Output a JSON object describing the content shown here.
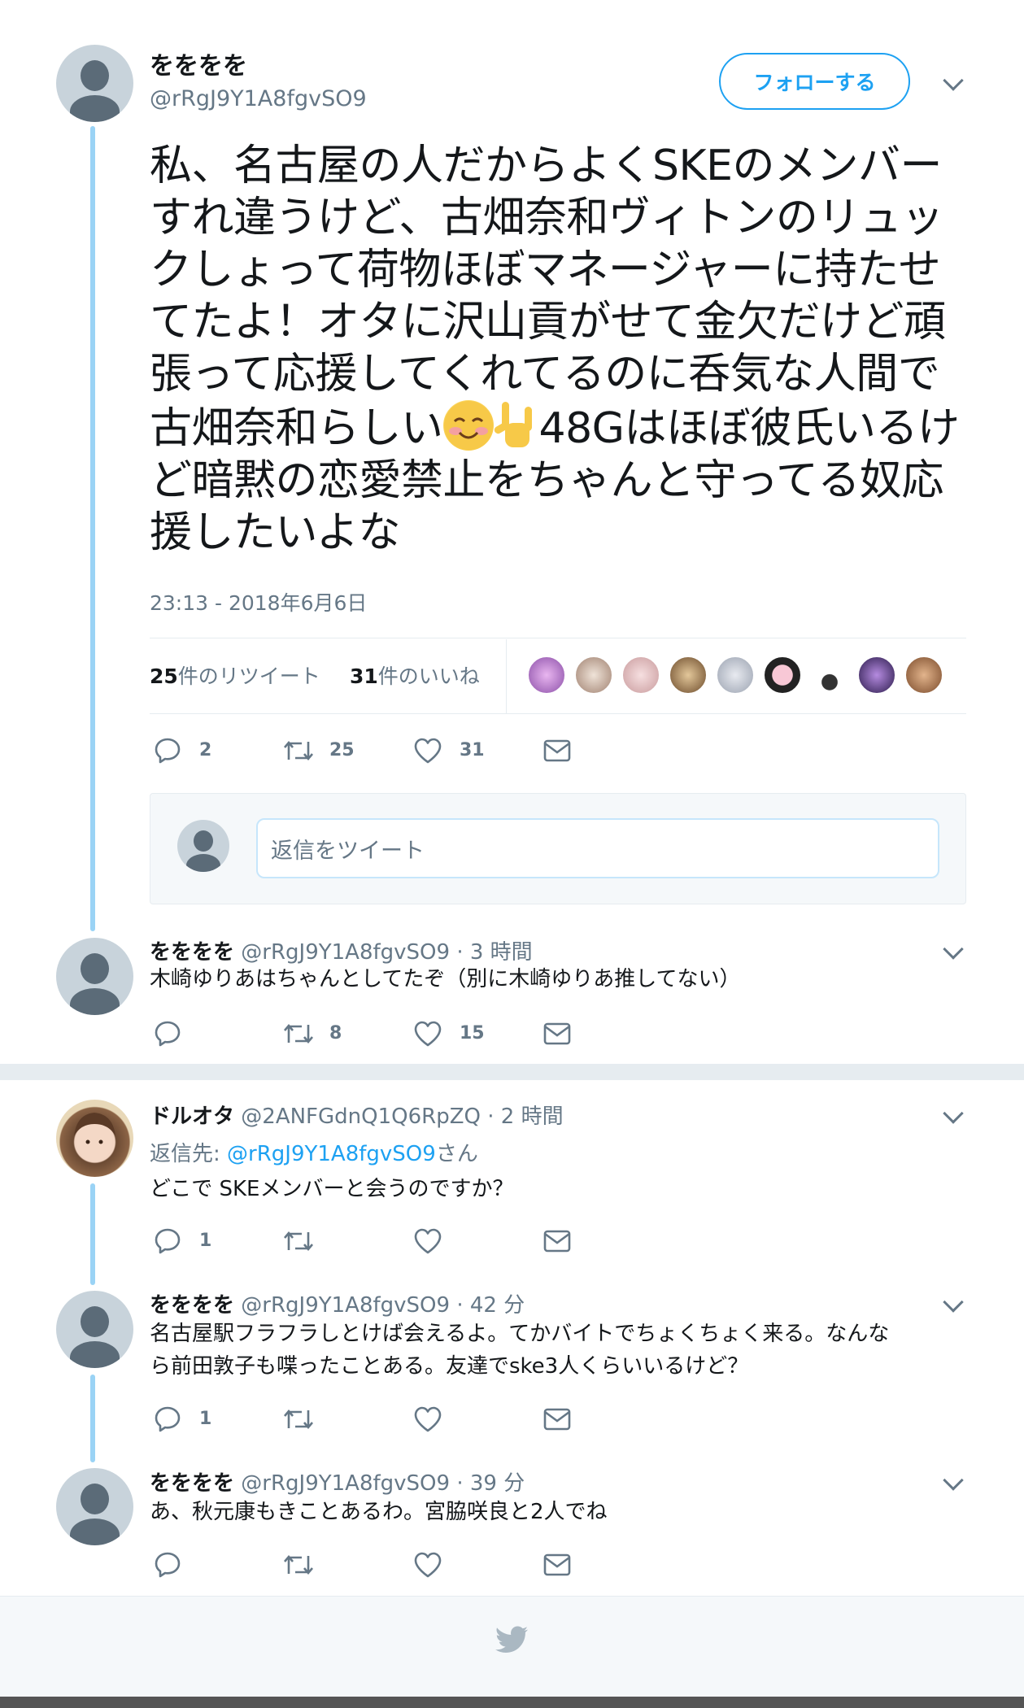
{
  "main_tweet": {
    "name": "をををを",
    "handle": "@rRgJ9Y1A8fgvSO9",
    "follow_label": "フォローする",
    "text_part1": "私、名古屋の人だからよくSKEのメンバーすれ違うけど、古畑奈和ヴィトンのリュックしょって荷物ほぼマネージャーに持たせてたよ！オタに沢山貢がせて金欠だけど頑張って応援してくれてるのに呑気な人間で古畑奈和らしい",
    "emoji1": "smiling-face-icon",
    "emoji2": "love-you-gesture-icon",
    "text_part2": "48Gはほぼ彼氏いるけど暗黙の恋愛禁止をちゃんと守ってる奴応援したいよな",
    "timestamp": "23:13 - 2018年6月6日",
    "retweets_num": "25",
    "retweets_label": "件のリツイート",
    "likes_num": "31",
    "likes_label": "件のいいね",
    "reply_count": "2",
    "retweet_count": "25",
    "like_count": "31",
    "reply_placeholder": "返信をツイート"
  },
  "replies": [
    {
      "name": "をををを",
      "handle": "@rRgJ9Y1A8fgvSO9",
      "time": "· 3 時間",
      "text": "木崎ゆりあはちゃんとしてたぞ（別に木崎ゆりあ推してない）",
      "reply_count": "",
      "retweet_count": "8",
      "like_count": "15"
    },
    {
      "name": "ドルオタ",
      "handle": "@2ANFGdnQ1Q6RpZQ",
      "time": "· 2 時間",
      "reply_to_label": "返信先: ",
      "reply_to_handle": "@rRgJ9Y1A8fgvSO9",
      "reply_to_suffix": "さん",
      "text": "どこで SKEメンバーと会うのですか？",
      "reply_count": "1",
      "retweet_count": "",
      "like_count": ""
    },
    {
      "name": "をををを",
      "handle": "@rRgJ9Y1A8fgvSO9",
      "time": "· 42 分",
      "text_line1": "名古屋駅フラフラしとけば会えるよ。てかバイトでちょくちょく来る。なんな",
      "text_line2": "ら前田敦子も喋ったことある。友達でske3人くらいいるけど？",
      "reply_count": "1",
      "retweet_count": "",
      "like_count": ""
    },
    {
      "name": "をををを",
      "handle": "@rRgJ9Y1A8fgvSO9",
      "time": "· 39 分",
      "text": "あ、秋元康もきことあるわ。宮脇咲良と2人でね",
      "reply_count": "",
      "retweet_count": "",
      "like_count": ""
    }
  ],
  "footer_icon": "twitter-bird-icon",
  "colors": {
    "accent": "#1da1f2",
    "thread_line": "#9ad3f5",
    "muted": "#657786"
  }
}
